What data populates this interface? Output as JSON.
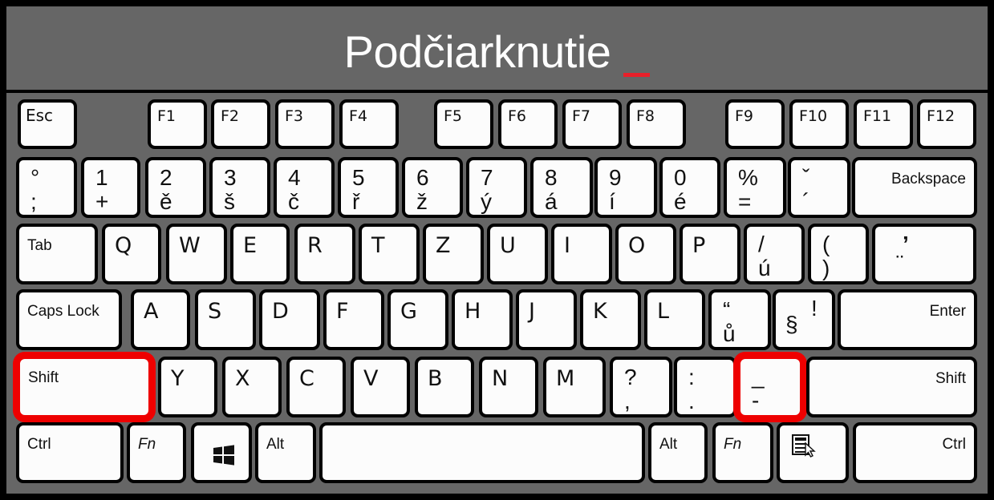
{
  "title": {
    "text": "Podčiarknutie",
    "underscore_color": "#e8202a"
  },
  "highlight_color": "#ee0000",
  "rows": {
    "function": [
      {
        "id": "esc",
        "label": "Esc"
      },
      {
        "id": "f1",
        "label": "F1"
      },
      {
        "id": "f2",
        "label": "F2"
      },
      {
        "id": "f3",
        "label": "F3"
      },
      {
        "id": "f4",
        "label": "F4"
      },
      {
        "id": "f5",
        "label": "F5"
      },
      {
        "id": "f6",
        "label": "F6"
      },
      {
        "id": "f7",
        "label": "F7"
      },
      {
        "id": "f8",
        "label": "F8"
      },
      {
        "id": "f9",
        "label": "F9"
      },
      {
        "id": "f10",
        "label": "F10"
      },
      {
        "id": "f11",
        "label": "F11"
      },
      {
        "id": "f12",
        "label": "F12"
      }
    ],
    "number": [
      {
        "id": "semicolon",
        "top": "°",
        "bottom": ";"
      },
      {
        "id": "1",
        "top": "1",
        "bottom": "+"
      },
      {
        "id": "2",
        "top": "2",
        "bottom": "ě"
      },
      {
        "id": "3",
        "top": "3",
        "bottom": "š"
      },
      {
        "id": "4",
        "top": "4",
        "bottom": "č"
      },
      {
        "id": "5",
        "top": "5",
        "bottom": "ř"
      },
      {
        "id": "6",
        "top": "6",
        "bottom": "ž"
      },
      {
        "id": "7",
        "top": "7",
        "bottom": "ý"
      },
      {
        "id": "8",
        "top": "8",
        "bottom": "á"
      },
      {
        "id": "9",
        "top": "9",
        "bottom": "í"
      },
      {
        "id": "0",
        "top": "0",
        "bottom": "é"
      },
      {
        "id": "equals",
        "top": "%",
        "bottom": "="
      },
      {
        "id": "acute",
        "top": "ˇ",
        "bottom": "´"
      },
      {
        "id": "backspace",
        "label": "Backspace"
      }
    ],
    "qwerty": [
      {
        "id": "tab",
        "label": "Tab"
      },
      {
        "id": "q",
        "label": "Q"
      },
      {
        "id": "w",
        "label": "W"
      },
      {
        "id": "e",
        "label": "E"
      },
      {
        "id": "r",
        "label": "R"
      },
      {
        "id": "t",
        "label": "T"
      },
      {
        "id": "z",
        "label": "Z"
      },
      {
        "id": "u",
        "label": "U"
      },
      {
        "id": "i",
        "label": "I"
      },
      {
        "id": "o",
        "label": "O"
      },
      {
        "id": "p",
        "label": "P"
      },
      {
        "id": "u-acute",
        "top": "/",
        "bottom": "ú"
      },
      {
        "id": "paren",
        "top": "(",
        "bottom": ")"
      },
      {
        "id": "quote",
        "top": "’",
        "bottom": "¨"
      }
    ],
    "home": [
      {
        "id": "capslock",
        "label": "Caps Lock"
      },
      {
        "id": "a",
        "label": "A"
      },
      {
        "id": "s",
        "label": "S"
      },
      {
        "id": "d",
        "label": "D"
      },
      {
        "id": "f",
        "label": "F"
      },
      {
        "id": "g",
        "label": "G"
      },
      {
        "id": "h",
        "label": "H"
      },
      {
        "id": "j",
        "label": "J"
      },
      {
        "id": "k",
        "label": "K"
      },
      {
        "id": "l",
        "label": "L"
      },
      {
        "id": "u-ring",
        "top": "“",
        "bottom": "ů"
      },
      {
        "id": "section",
        "top": "!",
        "bottom": "§"
      },
      {
        "id": "enter",
        "label": "Enter"
      }
    ],
    "shift": [
      {
        "id": "lshift",
        "label": "Shift",
        "highlighted": true
      },
      {
        "id": "y",
        "label": "Y"
      },
      {
        "id": "x",
        "label": "X"
      },
      {
        "id": "c",
        "label": "C"
      },
      {
        "id": "v",
        "label": "V"
      },
      {
        "id": "b",
        "label": "B"
      },
      {
        "id": "n",
        "label": "N"
      },
      {
        "id": "m",
        "label": "M"
      },
      {
        "id": "comma",
        "top": "?",
        "bottom": ","
      },
      {
        "id": "period",
        "top": ":",
        "bottom": "."
      },
      {
        "id": "minus",
        "top": "_",
        "bottom": "-",
        "highlighted": true
      },
      {
        "id": "rshift",
        "label": "Shift"
      }
    ],
    "bottom": [
      {
        "id": "lctrl",
        "label": "Ctrl"
      },
      {
        "id": "lfn",
        "label": "Fn"
      },
      {
        "id": "win",
        "icon": "windows-logo-icon"
      },
      {
        "id": "lalt",
        "label": "Alt"
      },
      {
        "id": "space",
        "label": ""
      },
      {
        "id": "ralt",
        "label": "Alt"
      },
      {
        "id": "rfn",
        "label": "Fn"
      },
      {
        "id": "menu",
        "icon": "context-menu-icon"
      },
      {
        "id": "rctrl",
        "label": "Ctrl"
      }
    ]
  }
}
